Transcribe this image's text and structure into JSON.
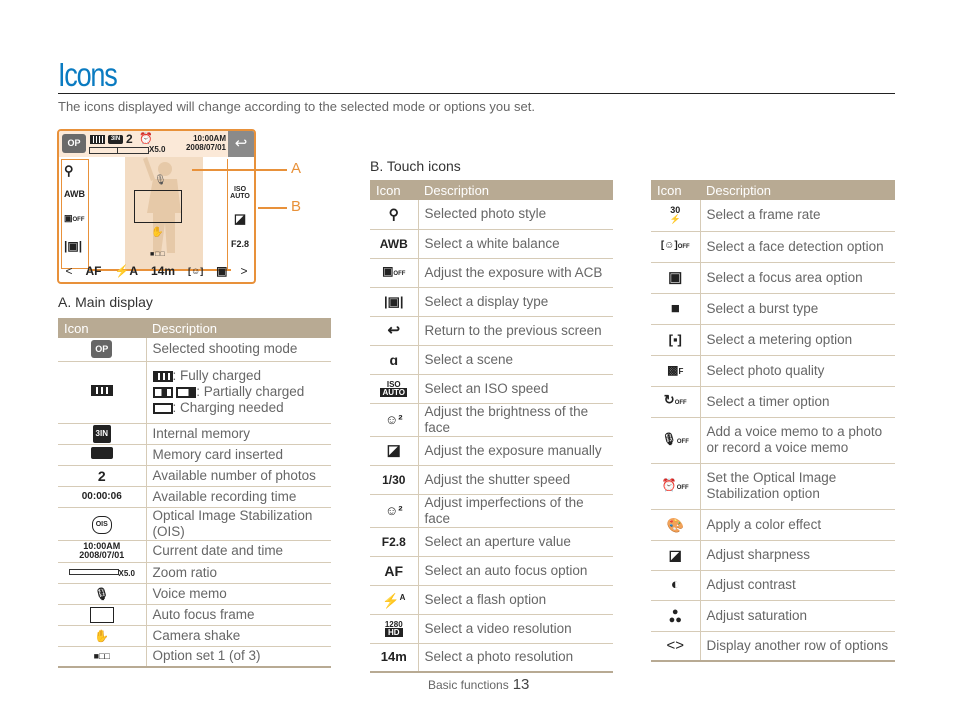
{
  "page": {
    "title": "Icons",
    "subtitle": "The icons displayed will change according to the selected mode or options you set."
  },
  "camera_screen": {
    "mode_icon": "OP",
    "photo_count": "2",
    "zoom_value": "X5.0",
    "time": "10:00AM",
    "date": "2008/07/01",
    "back_icon": "↩",
    "left_icons": [
      "photo-style",
      "AWB",
      "ACB off",
      "display type"
    ],
    "right_icons": [
      "ISO AUTO",
      "±",
      "F2.8"
    ],
    "bottom_icons": [
      "<",
      "AF",
      "⚡A",
      "14m",
      "face off",
      "▣",
      ">"
    ],
    "option_dots": "■□□",
    "callout_a": "A",
    "callout_b": "B"
  },
  "main_display": {
    "label": "A. Main display",
    "headers": [
      "Icon",
      "Description"
    ],
    "rows": [
      {
        "icon": "OP",
        "desc": "Selected shooting mode"
      },
      {
        "icon": "battery",
        "desc": ": Fully charged",
        "desc2": ": Partially charged",
        "desc3": ": Charging needed"
      },
      {
        "icon": "3IN",
        "desc": "Internal memory"
      },
      {
        "icon": "card",
        "desc": "Memory card inserted"
      },
      {
        "icon": "2",
        "desc": "Available number of photos"
      },
      {
        "icon": "00:00:06",
        "desc": "Available recording time"
      },
      {
        "icon": "OIS",
        "desc": "Optical Image Stabilization (OIS)"
      },
      {
        "icon": "10:00AM 2008/07/01",
        "icon_line1": "10:00AM",
        "icon_line2": "2008/07/01",
        "desc": "Current date and time"
      },
      {
        "icon": "X5.0",
        "desc": "Zoom ratio"
      },
      {
        "icon": "mic",
        "desc": "Voice memo"
      },
      {
        "icon": "af-frame",
        "desc": "Auto focus frame"
      },
      {
        "icon": "shake",
        "desc": "Camera shake"
      },
      {
        "icon": "■□□",
        "desc": "Option set 1 (of 3)"
      }
    ]
  },
  "touch_icons": {
    "label": "B. Touch icons",
    "headers": [
      "Icon",
      "Description"
    ],
    "left_rows": [
      {
        "icon": "photo-style",
        "desc": "Selected photo style"
      },
      {
        "icon": "AWB",
        "desc": "Select a white balance"
      },
      {
        "icon": "ACB",
        "desc": "Adjust the exposure with ACB"
      },
      {
        "icon": "display",
        "desc": "Select a display type"
      },
      {
        "icon": "back",
        "desc": "Return to the previous screen"
      },
      {
        "icon": "scene",
        "desc": "Select a scene"
      },
      {
        "icon": "ISO AUTO",
        "desc": "Select an ISO speed"
      },
      {
        "icon": "face-bright",
        "desc": "Adjust the brightness of the face"
      },
      {
        "icon": "exposure",
        "desc": "Adjust the exposure manually"
      },
      {
        "icon": "1/30",
        "desc": "Adjust the shutter speed"
      },
      {
        "icon": "face-retouch",
        "desc": "Adjust imperfections of the face"
      },
      {
        "icon": "F2.8",
        "desc": "Select an aperture value"
      },
      {
        "icon": "AF",
        "desc": "Select an auto focus option"
      },
      {
        "icon": "flash",
        "desc": "Select a flash option"
      },
      {
        "icon": "1280 HD",
        "desc": "Select a video resolution"
      },
      {
        "icon": "14m",
        "desc": "Select a photo resolution"
      }
    ],
    "right_rows": [
      {
        "icon": "30 fps",
        "desc": "Select a frame rate"
      },
      {
        "icon": "face-detect-off",
        "desc": "Select a face detection option"
      },
      {
        "icon": "focus-area",
        "desc": "Select a focus area option"
      },
      {
        "icon": "burst",
        "desc": "Select a burst type"
      },
      {
        "icon": "metering",
        "desc": "Select a metering option"
      },
      {
        "icon": "quality",
        "desc": "Select photo quality"
      },
      {
        "icon": "timer-off",
        "desc": "Select a timer option"
      },
      {
        "icon": "voice-off",
        "desc": "Add a voice memo to a photo or record a voice memo"
      },
      {
        "icon": "ois-off",
        "desc": "Set the Optical Image Stabilization option"
      },
      {
        "icon": "color-effect",
        "desc": "Apply a color effect"
      },
      {
        "icon": "sharpness",
        "desc": "Adjust sharpness"
      },
      {
        "icon": "contrast",
        "desc": "Adjust contrast"
      },
      {
        "icon": "saturation",
        "desc": "Adjust saturation"
      },
      {
        "icon": "arrows",
        "desc": "Display another row of options"
      }
    ]
  },
  "footer": {
    "section": "Basic functions",
    "page_number": "13"
  }
}
